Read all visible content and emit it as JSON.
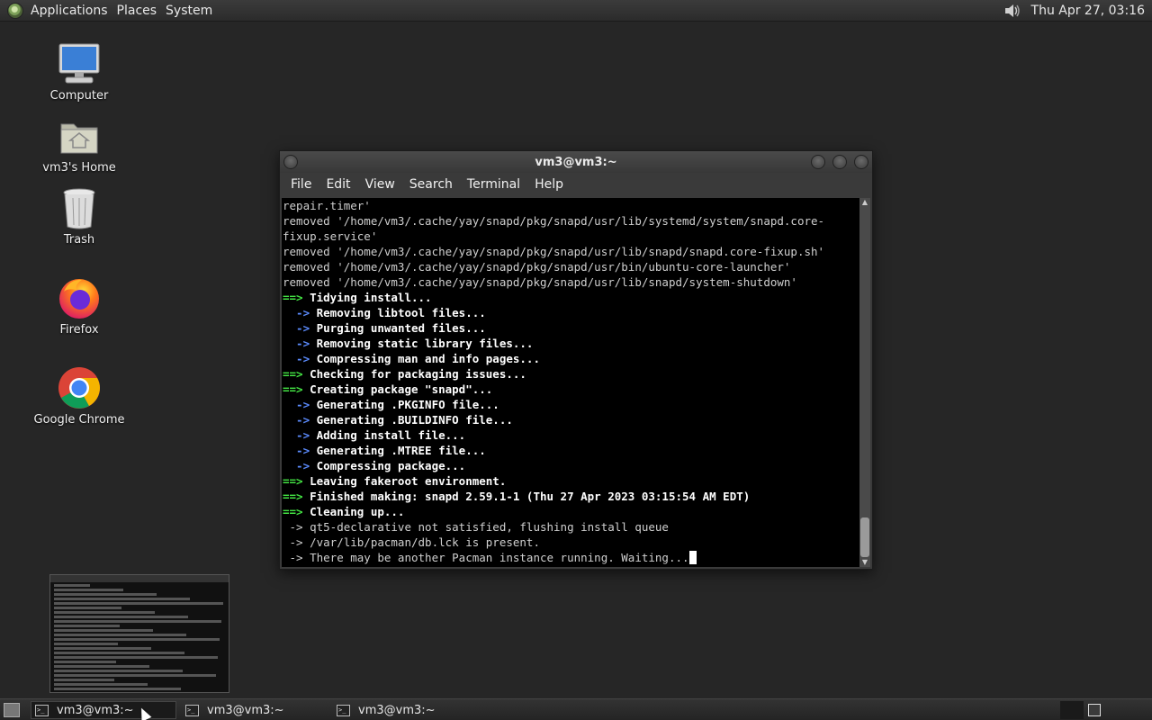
{
  "top_panel": {
    "menus": [
      "Applications",
      "Places",
      "System"
    ],
    "clock": "Thu Apr 27, 03:16"
  },
  "desktop_icons": [
    {
      "label": "Computer",
      "icon": "computer-icon"
    },
    {
      "label": "vm3's Home",
      "icon": "home-folder-icon"
    },
    {
      "label": "Trash",
      "icon": "trash-icon"
    },
    {
      "label": "Firefox",
      "icon": "firefox-icon"
    },
    {
      "label": "Google Chrome",
      "icon": "chrome-icon"
    }
  ],
  "terminal": {
    "title": "vm3@vm3:~",
    "menu": [
      "File",
      "Edit",
      "View",
      "Search",
      "Terminal",
      "Help"
    ],
    "lines": [
      {
        "prefix": "",
        "text": "repair.timer'",
        "style": "plain"
      },
      {
        "prefix": "",
        "text": "removed '/home/vm3/.cache/yay/snapd/pkg/snapd/usr/lib/systemd/system/snapd.core-",
        "style": "plain"
      },
      {
        "prefix": "",
        "text": "fixup.service'",
        "style": "plain"
      },
      {
        "prefix": "",
        "text": "removed '/home/vm3/.cache/yay/snapd/pkg/snapd/usr/lib/snapd/snapd.core-fixup.sh'",
        "style": "plain"
      },
      {
        "prefix": "",
        "text": "removed '/home/vm3/.cache/yay/snapd/pkg/snapd/usr/bin/ubuntu-core-launcher'",
        "style": "plain"
      },
      {
        "prefix": "",
        "text": "removed '/home/vm3/.cache/yay/snapd/pkg/snapd/usr/lib/snapd/system-shutdown'",
        "style": "plain"
      },
      {
        "prefix": "==>",
        "text": " Tidying install...",
        "style": "green"
      },
      {
        "prefix": "  ->",
        "text": " Removing libtool files...",
        "style": "blue"
      },
      {
        "prefix": "  ->",
        "text": " Purging unwanted files...",
        "style": "blue"
      },
      {
        "prefix": "  ->",
        "text": " Removing static library files...",
        "style": "blue"
      },
      {
        "prefix": "  ->",
        "text": " Compressing man and info pages...",
        "style": "blue"
      },
      {
        "prefix": "==>",
        "text": " Checking for packaging issues...",
        "style": "green"
      },
      {
        "prefix": "==>",
        "text": " Creating package \"snapd\"...",
        "style": "green"
      },
      {
        "prefix": "  ->",
        "text": " Generating .PKGINFO file...",
        "style": "blue"
      },
      {
        "prefix": "  ->",
        "text": " Generating .BUILDINFO file...",
        "style": "blue"
      },
      {
        "prefix": "  ->",
        "text": " Adding install file...",
        "style": "blue"
      },
      {
        "prefix": "  ->",
        "text": " Generating .MTREE file...",
        "style": "blue"
      },
      {
        "prefix": "  ->",
        "text": " Compressing package...",
        "style": "blue"
      },
      {
        "prefix": "==>",
        "text": " Leaving fakeroot environment.",
        "style": "green"
      },
      {
        "prefix": "==>",
        "text": " Finished making: snapd 2.59.1-1 (Thu 27 Apr 2023 03:15:54 AM EDT)",
        "style": "green"
      },
      {
        "prefix": "==>",
        "text": " Cleaning up...",
        "style": "green"
      },
      {
        "prefix": "",
        "text": " -> qt5-declarative not satisfied, flushing install queue",
        "style": "plain"
      },
      {
        "prefix": "",
        "text": " -> /var/lib/pacman/db.lck is present.",
        "style": "plain"
      },
      {
        "prefix": "",
        "text": " -> There may be another Pacman instance running. Waiting...",
        "style": "plain"
      }
    ]
  },
  "taskbar": {
    "tasks": [
      "vm3@vm3:~",
      "vm3@vm3:~",
      "vm3@vm3:~"
    ]
  }
}
